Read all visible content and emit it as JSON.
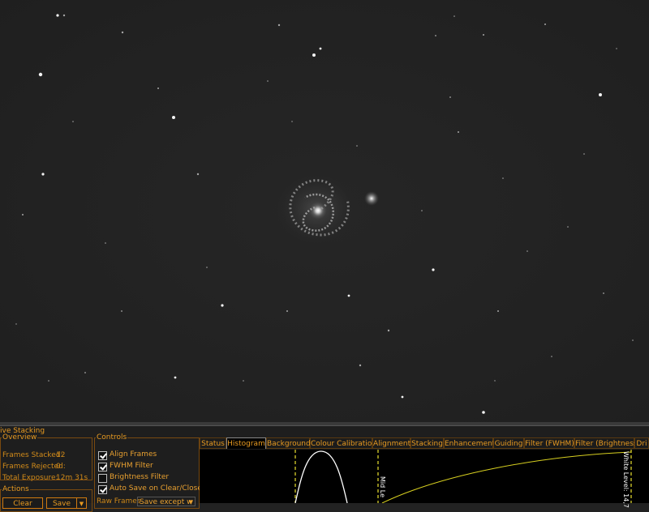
{
  "window": {
    "title": "ive Stacking"
  },
  "overview": {
    "legend": "Overview",
    "frames_stacked_label": "Frames Stacked:",
    "frames_stacked_value": "12",
    "frames_rejected_label": "Frames Rejected:",
    "frames_rejected_value": "0",
    "total_exposure_label": "Total Exposure:",
    "total_exposure_value": "12m 31s"
  },
  "actions": {
    "legend": "Actions",
    "clear_label": "Clear",
    "save_label": "Save"
  },
  "controls": {
    "legend": "Controls",
    "items": [
      {
        "label": "Align Frames",
        "checked": true
      },
      {
        "label": "FWHM Filter",
        "checked": true
      },
      {
        "label": "Brightness Filter",
        "checked": false
      },
      {
        "label": "Auto Save on Clear/Close",
        "checked": true
      }
    ],
    "raw_frames_label": "Raw Frames",
    "raw_frames_value": "Save except w"
  },
  "tabs": [
    {
      "label": "Status",
      "active": false
    },
    {
      "label": "Histogram",
      "active": true
    },
    {
      "label": "Background",
      "active": false
    },
    {
      "label": "Colour Calibration",
      "active": false
    },
    {
      "label": "Alignment",
      "active": false
    },
    {
      "label": "Stacking",
      "active": false
    },
    {
      "label": "Enhancement",
      "active": false
    },
    {
      "label": "Guiding",
      "active": false
    },
    {
      "label": "Filter (FWHM)",
      "active": false
    },
    {
      "label": "Filter (Brightness)",
      "active": false
    },
    {
      "label": "Dri",
      "active": false
    }
  ],
  "histogram": {
    "mid_level_label": "Mid Le",
    "white_level_label": "White Level: 14,7"
  },
  "colors": {
    "accent": "#e89a20",
    "marker": "#e8e030",
    "sky": "#222222"
  }
}
